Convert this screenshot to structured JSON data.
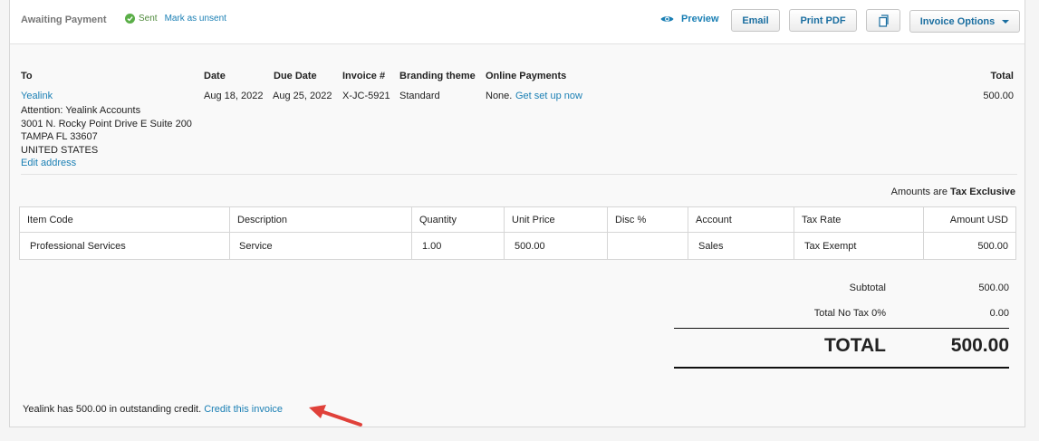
{
  "header": {
    "status": "Awaiting Payment",
    "sent_label": "Sent",
    "mark_unsent": "Mark as unsent",
    "preview": "Preview",
    "email": "Email",
    "print_pdf": "Print PDF",
    "invoice_options": "Invoice Options"
  },
  "details": {
    "to_label": "To",
    "date_label": "Date",
    "due_label": "Due Date",
    "invoice_label": "Invoice #",
    "branding_label": "Branding theme",
    "online_label": "Online Payments",
    "total_label": "Total",
    "contact": "Yealink",
    "address": [
      "Attention: Yealink Accounts",
      "3001 N. Rocky Point Drive E Suite 200",
      "TAMPA FL 33607",
      "UNITED STATES"
    ],
    "edit_address": "Edit address",
    "date": "Aug 18, 2022",
    "due_date": "Aug 25, 2022",
    "invoice_number": "X-JC-5921",
    "branding": "Standard",
    "online_none": "None.",
    "online_link": "Get set up now",
    "total": "500.00"
  },
  "amounts_are": "Amounts are",
  "tax_mode": "Tax Exclusive",
  "table": {
    "columns": [
      "Item Code",
      "Description",
      "Quantity",
      "Unit Price",
      "Disc %",
      "Account",
      "Tax Rate",
      "Amount USD"
    ],
    "rows": [
      [
        "Professional Services",
        "Service",
        "1.00",
        "500.00",
        "",
        "Sales",
        "Tax Exempt",
        "500.00"
      ]
    ]
  },
  "totals": {
    "subtotal_label": "Subtotal",
    "subtotal": "500.00",
    "tax_label": "Total No Tax 0%",
    "tax": "0.00",
    "total_label": "TOTAL",
    "total": "500.00"
  },
  "footer": {
    "credit_text": "Yealink has 500.00 in outstanding credit.",
    "credit_link": "Credit this invoice"
  },
  "colors": {
    "link": "#1a7fb4",
    "sent_green": "#5aae47",
    "arrow_red": "#e0413a"
  }
}
